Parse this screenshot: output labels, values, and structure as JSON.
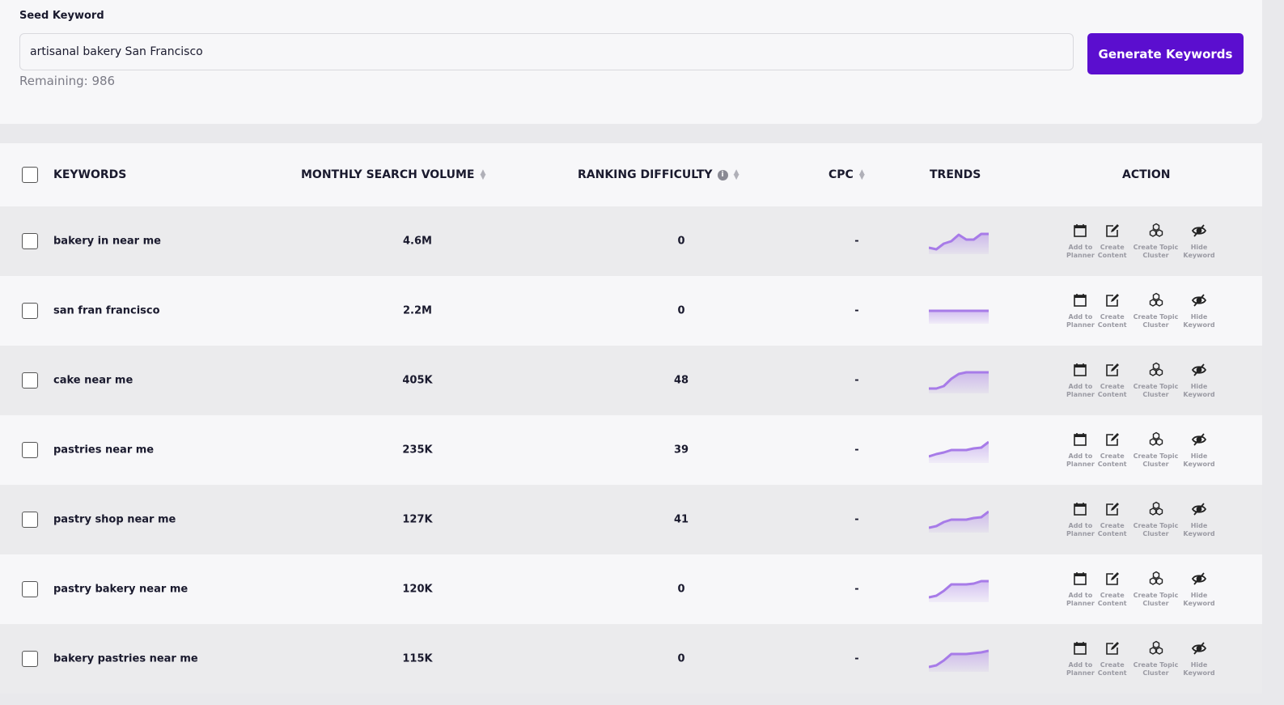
{
  "seed": {
    "label": "Seed Keyword",
    "value": "artisanal bakery San Francisco",
    "remaining": "Remaining: 986",
    "button": "Generate Keywords"
  },
  "colors": {
    "accent": "#5b0ecf",
    "trend": "#a77be8"
  },
  "headers": {
    "keywords": "KEYWORDS",
    "volume": "MONTHLY SEARCH VOLUME",
    "difficulty": "RANKING DIFFICULTY",
    "cpc": "CPC",
    "trends": "TRENDS",
    "action": "ACTION"
  },
  "action_labels": [
    {
      "line1": "Add to",
      "line2": "Planner",
      "icon": "calendar-icon"
    },
    {
      "line1": "Create",
      "line2": "Content",
      "icon": "edit-icon"
    },
    {
      "line1": "Create Topic",
      "line2": "Cluster",
      "icon": "cluster-icon"
    },
    {
      "line1": "Hide",
      "line2": "Keyword",
      "icon": "eye-off-icon"
    }
  ],
  "rows": [
    {
      "keyword": "bakery in near me",
      "volume": "4.6M",
      "difficulty": "0",
      "cpc": "-",
      "trend": [
        0.1,
        0,
        0.35,
        0.5,
        0.9,
        0.6,
        0.6,
        0.95,
        0.95
      ]
    },
    {
      "keyword": "san fran francisco",
      "volume": "2.2M",
      "difficulty": "0",
      "cpc": "-",
      "trend": [
        0.5,
        0.5,
        0.5,
        0.5,
        0.5,
        0.5,
        0.5,
        0.5,
        0.5
      ]
    },
    {
      "keyword": "cake near me",
      "volume": "405K",
      "difficulty": "48",
      "cpc": "-",
      "trend": [
        0,
        0,
        0.15,
        0.6,
        0.9,
        1,
        1,
        1,
        1
      ]
    },
    {
      "keyword": "pastries near me",
      "volume": "235K",
      "difficulty": "39",
      "cpc": "-",
      "trend": [
        0.1,
        0.25,
        0.35,
        0.5,
        0.5,
        0.5,
        0.6,
        0.65,
        1
      ]
    },
    {
      "keyword": "pastry shop near me",
      "volume": "127K",
      "difficulty": "41",
      "cpc": "-",
      "trend": [
        0,
        0.1,
        0.35,
        0.5,
        0.5,
        0.5,
        0.6,
        0.65,
        1
      ]
    },
    {
      "keyword": "pastry bakery near me",
      "volume": "120K",
      "difficulty": "0",
      "cpc": "-",
      "trend": [
        0,
        0.1,
        0.4,
        0.8,
        0.8,
        0.8,
        0.85,
        1,
        1
      ]
    },
    {
      "keyword": "bakery pastries near me",
      "volume": "115K",
      "difficulty": "0",
      "cpc": "-",
      "trend": [
        0,
        0.1,
        0.4,
        0.8,
        0.8,
        0.8,
        0.85,
        0.9,
        1
      ]
    }
  ]
}
